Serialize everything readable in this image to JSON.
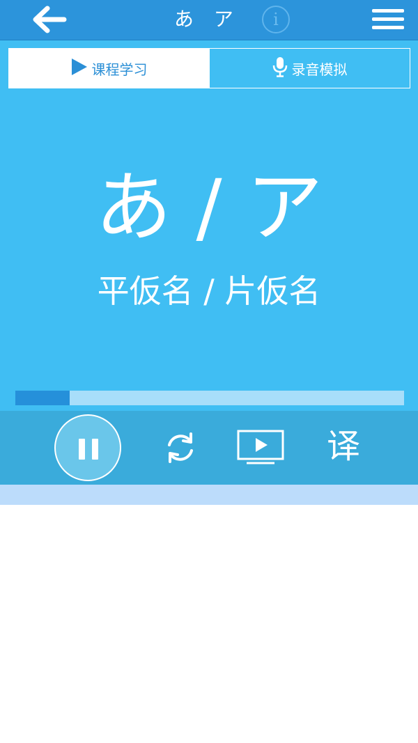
{
  "header": {
    "back_icon": "arrow-left-icon",
    "title": "あ ア",
    "info_label": "i",
    "menu_icon": "hamburger-menu-icon",
    "color": "#2c94db"
  },
  "tabs": [
    {
      "label": "课程学习",
      "icon": "play-triangle-icon",
      "active": true
    },
    {
      "label": "录音模拟",
      "icon": "microphone-icon",
      "active": false
    }
  ],
  "lesson": {
    "kana": "あ / ア",
    "kana_label": "平仮名 / 片仮名",
    "progress_fraction": 0.14,
    "background_color": "#40bef3"
  },
  "controls": {
    "pause_icon": "pause-icon",
    "refresh_icon": "refresh-icon",
    "video_icon": "video-play-icon",
    "translate_label": "译"
  },
  "colors": {
    "accent": "#2590da",
    "progress_track": "#a8defa",
    "control_bar": "#3aabdb"
  }
}
